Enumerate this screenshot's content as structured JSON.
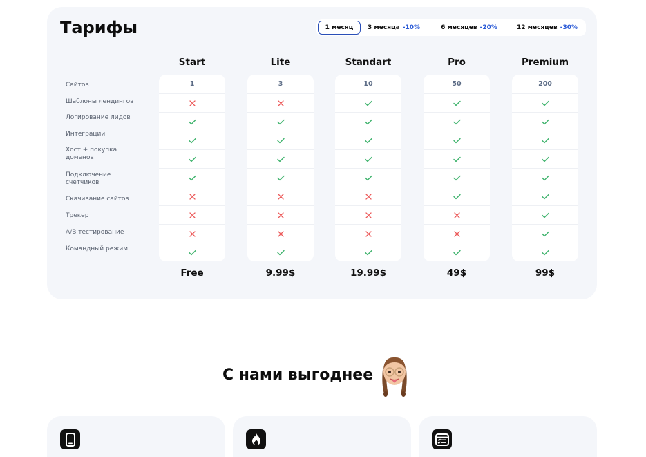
{
  "pricing": {
    "title": "Тарифы",
    "periods": [
      {
        "label": "1 месяц",
        "discount": "",
        "active": true
      },
      {
        "label": "3 месяца",
        "discount": "-10%",
        "active": false
      },
      {
        "label": "6 месяцев",
        "discount": "-20%",
        "active": false
      },
      {
        "label": "12 месяцев",
        "discount": "-30%",
        "active": false
      }
    ],
    "features": [
      "Сайтов",
      "Шаблоны лендингов",
      "Логирование лидов",
      "Интеграции",
      "Хост + покупка доменов",
      "Подключение счетчиков",
      "Скачивание сайтов",
      "Трекер",
      "A/B тестирование",
      "Командный режим"
    ],
    "plans": [
      {
        "name": "Start",
        "price": "Free",
        "sites": "1",
        "values": [
          false,
          true,
          true,
          true,
          true,
          false,
          false,
          false,
          true
        ]
      },
      {
        "name": "Lite",
        "price": "9.99$",
        "sites": "3",
        "values": [
          false,
          true,
          true,
          true,
          true,
          false,
          false,
          false,
          true
        ]
      },
      {
        "name": "Standart",
        "price": "19.99$",
        "sites": "10",
        "values": [
          true,
          true,
          true,
          true,
          true,
          false,
          false,
          false,
          true
        ]
      },
      {
        "name": "Pro",
        "price": "49$",
        "sites": "50",
        "values": [
          true,
          true,
          true,
          true,
          true,
          true,
          false,
          false,
          true
        ]
      },
      {
        "name": "Premium",
        "price": "99$",
        "sites": "200",
        "values": [
          true,
          true,
          true,
          true,
          true,
          true,
          true,
          true,
          true
        ]
      }
    ],
    "colors": {
      "check": "#3bb26a",
      "cross": "#ec5b5b",
      "accent": "#2a5ad6"
    }
  },
  "benefits": {
    "heading": "С нами выгоднее",
    "cards": [
      {
        "icon": "phone-icon"
      },
      {
        "icon": "fire-icon"
      },
      {
        "icon": "browser-list-icon"
      }
    ]
  }
}
